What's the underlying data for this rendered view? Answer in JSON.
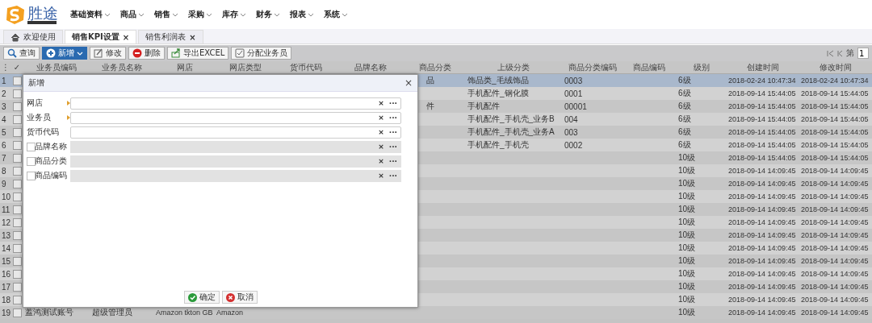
{
  "app": {
    "logo_text": "胜途"
  },
  "menu": [
    {
      "label": "基础资料"
    },
    {
      "label": "商品"
    },
    {
      "label": "销售"
    },
    {
      "label": "采购"
    },
    {
      "label": "库存"
    },
    {
      "label": "财务"
    },
    {
      "label": "报表"
    },
    {
      "label": "系统"
    }
  ],
  "tabs": [
    {
      "label": "欢迎使用",
      "selected": false,
      "kind": "home"
    },
    {
      "label": "销售KPI设置",
      "selected": true,
      "close": "×",
      "kind": "page"
    },
    {
      "label": "销售利润表",
      "selected": false,
      "close": "×",
      "kind": "page"
    }
  ],
  "toolbar": [
    {
      "label": "查询",
      "kind": "search",
      "primary": false
    },
    {
      "label": "新增",
      "kind": "add",
      "primary": true
    },
    {
      "label": "修改",
      "kind": "edit",
      "primary": false
    },
    {
      "label": "删除",
      "kind": "delete",
      "primary": false
    },
    {
      "label": "导出EXCEL",
      "kind": "export",
      "primary": false
    },
    {
      "label": "分配业务员",
      "kind": "assign",
      "primary": false
    }
  ],
  "pager": {
    "page_label": "第",
    "page": "1"
  },
  "grid": {
    "menu_mark": "⋮",
    "check_mark": "✓",
    "columns": [
      "业务员编码",
      "业务员名称",
      "网店",
      "网店类型",
      "货币代码",
      "品牌名称",
      "商品分类",
      "上级分类",
      "商品分类编码",
      "商品编码",
      "级别",
      "创建时间",
      "修改时间"
    ],
    "rows": [
      {
        "number": "1",
        "selected": true,
        "checked": false,
        "category_tail": "品",
        "parent_category": "饰品类_毛绒饰品",
        "category_code": "0003",
        "grade": "6级",
        "created": "2018-02-24 10:47:34",
        "modified": "2018-02-24 10:47:34"
      },
      {
        "number": "2",
        "selected": false,
        "checked": false,
        "parent_category": "手机配件_钢化膜",
        "category_code": "0001",
        "grade": "6级",
        "created": "2018-09-14 15:44:05",
        "modified": "2018-09-14 15:44:05"
      },
      {
        "number": "3",
        "selected": false,
        "checked": false,
        "category_tail": "件",
        "parent_category": "手机配件",
        "category_code": "00001",
        "grade": "6级",
        "created": "2018-09-14 15:44:05",
        "modified": "2018-09-14 15:44:05"
      },
      {
        "number": "4",
        "selected": false,
        "checked": false,
        "parent_category": "手机配件_手机壳_业务B",
        "category_code": "004",
        "grade": "6级",
        "created": "2018-09-14 15:44:05",
        "modified": "2018-09-14 15:44:05"
      },
      {
        "number": "5",
        "selected": false,
        "checked": false,
        "parent_category": "手机配件_手机壳_业务A",
        "category_code": "003",
        "grade": "6级",
        "created": "2018-09-14 15:44:05",
        "modified": "2018-09-14 15:44:05"
      },
      {
        "number": "6",
        "selected": false,
        "checked": false,
        "parent_category": "手机配件_手机壳",
        "category_code": "0002",
        "grade": "6级",
        "created": "2018-09-14 15:44:05",
        "modified": "2018-09-14 15:44:05"
      },
      {
        "number": "7",
        "selected": false,
        "checked": false,
        "grade": "10级",
        "created": "2018-09-14 15:44:05",
        "modified": "2018-09-14 15:44:05"
      },
      {
        "number": "8",
        "selected": false,
        "checked": false,
        "grade": "10级",
        "created": "2018-09-14 14:09:45",
        "modified": "2018-09-14 14:09:45"
      },
      {
        "number": "9",
        "selected": false,
        "checked": false,
        "grade": "10级",
        "created": "2018-09-14 14:09:45",
        "modified": "2018-09-14 14:09:45"
      },
      {
        "number": "10",
        "selected": false,
        "checked": false,
        "grade": "10级",
        "created": "2018-09-14 14:09:45",
        "modified": "2018-09-14 14:09:45"
      },
      {
        "number": "11",
        "selected": false,
        "checked": false,
        "grade": "10级",
        "created": "2018-09-14 14:09:45",
        "modified": "2018-09-14 14:09:45"
      },
      {
        "number": "12",
        "selected": false,
        "checked": false,
        "grade": "10级",
        "created": "2018-09-14 14:09:45",
        "modified": "2018-09-14 14:09:45"
      },
      {
        "number": "13",
        "selected": false,
        "checked": false,
        "grade": "10级",
        "created": "2018-09-14 14:09:45",
        "modified": "2018-09-14 14:09:45"
      },
      {
        "number": "14",
        "selected": false,
        "checked": false,
        "grade": "10级",
        "created": "2018-09-14 14:09:45",
        "modified": "2018-09-14 14:09:45"
      },
      {
        "number": "15",
        "selected": false,
        "checked": false,
        "grade": "10级",
        "created": "2018-09-14 14:09:45",
        "modified": "2018-09-14 14:09:45"
      },
      {
        "number": "16",
        "selected": false,
        "checked": false,
        "grade": "10级",
        "created": "2018-09-14 14:09:45",
        "modified": "2018-09-14 14:09:45"
      },
      {
        "number": "17",
        "selected": false,
        "checked": false,
        "grade": "10级",
        "created": "2018-09-14 14:09:45",
        "modified": "2018-09-14 14:09:45"
      },
      {
        "number": "18",
        "selected": false,
        "checked": false,
        "grade": "10级",
        "created": "2018-09-14 14:09:45",
        "modified": "2018-09-14 14:09:45"
      },
      {
        "number": "19",
        "selected": false,
        "checked": false,
        "salesperson_code": "蓋鸿测试账号",
        "salesperson_name": "超级管理员",
        "shop": "Amazon tkton GB",
        "shop_type": "Amazon",
        "grade": "10级",
        "created": "2018-09-14 14:09:45",
        "modified": "2018-09-14 14:09:45"
      }
    ]
  },
  "dialog": {
    "title": "新增",
    "close": "×",
    "fields": [
      {
        "label": "网店",
        "required": true,
        "disabled": false
      },
      {
        "label": "业务员",
        "required": true,
        "disabled": false
      },
      {
        "label": "货币代码",
        "required": false,
        "disabled": false
      },
      {
        "label": "品牌名称",
        "required": false,
        "checked": false,
        "disabled": true
      },
      {
        "label": "商品分类",
        "required": false,
        "checked": false,
        "disabled": true
      },
      {
        "label": "商品编码",
        "required": false,
        "checked": false,
        "disabled": true
      }
    ],
    "clear_mark": "×",
    "more_mark": "···",
    "buttons": [
      {
        "label": "确定",
        "kind": "ok"
      },
      {
        "label": "取消",
        "kind": "cancel"
      }
    ]
  }
}
